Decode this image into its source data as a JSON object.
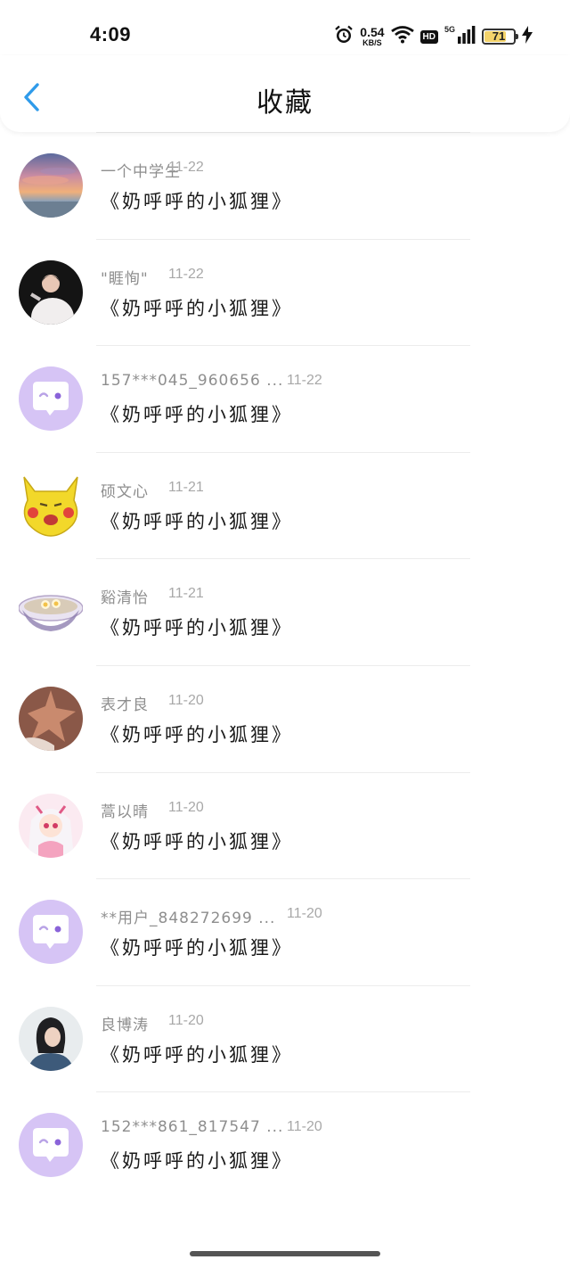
{
  "status_bar": {
    "time": "4:09",
    "net_speed_value": "0.54",
    "net_speed_unit": "KB/S",
    "hd": "HD",
    "network": "5G",
    "battery": "71",
    "icons": [
      "alarm-icon",
      "wifi-icon",
      "signal-icon",
      "battery-icon",
      "charging-icon"
    ]
  },
  "header": {
    "title": "收藏",
    "back_icon": "chevron-left-icon",
    "accent_color": "#2f9bea"
  },
  "items": [
    {
      "username": "一个中学生",
      "date": "11-22",
      "title": "《奶呼呼的小狐狸》",
      "avatar": "sunset-photo"
    },
    {
      "username": "\"睚恂\"",
      "date": "11-22",
      "title": "《奶呼呼的小狐狸》",
      "avatar": "performer-photo"
    },
    {
      "username": "157***045_960656 ...",
      "date": "11-22",
      "title": "《奶呼呼的小狐狸》",
      "avatar": "default-chat-avatar"
    },
    {
      "username": "硕文心",
      "date": "11-21",
      "title": "《奶呼呼的小狐狸》",
      "avatar": "yellow-cartoon"
    },
    {
      "username": "谿清怡",
      "date": "11-21",
      "title": "《奶呼呼的小狐狸》",
      "avatar": "noodle-bowl"
    },
    {
      "username": "表才良",
      "date": "11-20",
      "title": "《奶呼呼的小狐狸》",
      "avatar": "brown-photo"
    },
    {
      "username": "蒿以晴",
      "date": "11-20",
      "title": "《奶呼呼的小狐狸》",
      "avatar": "anime-girl"
    },
    {
      "username": "**用户_848272699 ...",
      "date": "11-20",
      "title": "《奶呼呼的小狐狸》",
      "avatar": "default-chat-avatar"
    },
    {
      "username": "良博涛",
      "date": "11-20",
      "title": "《奶呼呼的小狐狸》",
      "avatar": "portrait-photo"
    },
    {
      "username": "152***861_817547 ...",
      "date": "11-20",
      "title": "《奶呼呼的小狐狸》",
      "avatar": "default-chat-avatar"
    }
  ]
}
